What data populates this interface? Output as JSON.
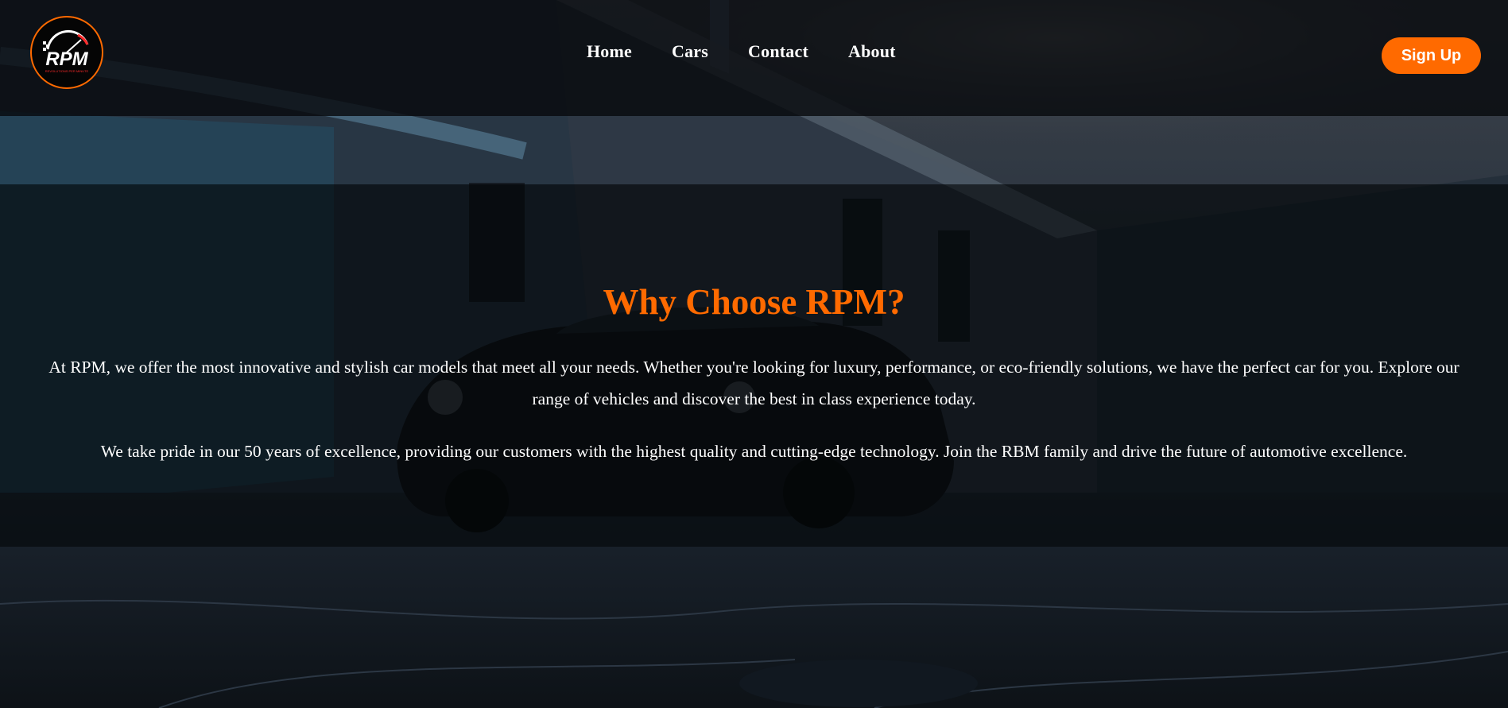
{
  "header": {
    "logo": {
      "text": "RPM",
      "tagline": "REVOLUTIONS PER MINUTE",
      "accent_color": "#ff6a00"
    },
    "nav": [
      {
        "label": "Home"
      },
      {
        "label": "Cars"
      },
      {
        "label": "Contact"
      },
      {
        "label": "About"
      }
    ],
    "signup_label": "Sign Up"
  },
  "why": {
    "title": "Why Choose RPM?",
    "paragraph1": "At RPM, we offer the most innovative and stylish car models that meet all your needs. Whether you're looking for luxury, performance, or eco-friendly solutions, we have the perfect car for you. Explore our range of vehicles and discover the best in class experience today.",
    "paragraph2": "We take pride in our 50 years of excellence, providing our customers with the highest quality and cutting-edge technology. Join the RBM family and drive the future of automotive excellence."
  },
  "colors": {
    "accent": "#ff6a00",
    "header_bg": "#080b0f",
    "text": "#ffffff"
  }
}
